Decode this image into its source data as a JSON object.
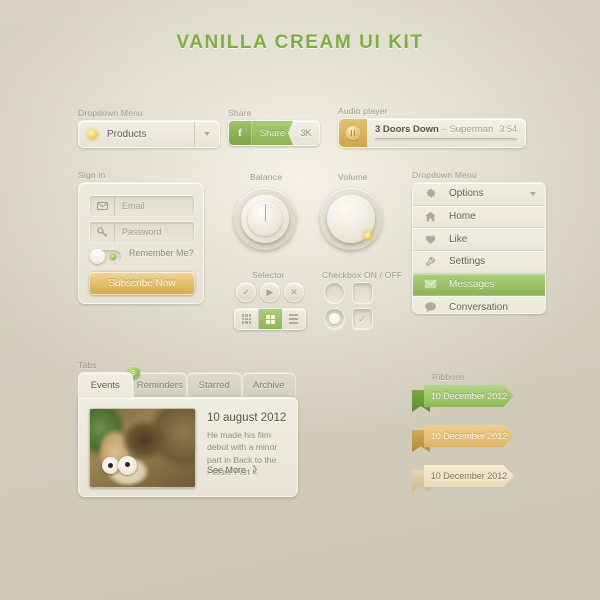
{
  "page": {
    "title": "VANILLA CREAM UI KIT"
  },
  "dropdown": {
    "caption": "Dropdown Menu",
    "selected": "Products",
    "icon": "bulb-icon",
    "caret": "chevron-down-icon"
  },
  "share": {
    "caption": "Share",
    "network_icon": "f",
    "label": "Share",
    "count": "3K"
  },
  "audio": {
    "caption": "Audio player",
    "transport_icon": "pause-icon",
    "artist": "3 Doors Down",
    "separator": " – ",
    "song": "Superman",
    "time": "3:54",
    "progress_percent": 60
  },
  "signin": {
    "caption": "Sign in",
    "email_placeholder": "Email",
    "email_icon": "envelope-icon",
    "password_placeholder": "Password",
    "password_icon": "key-icon",
    "remember_label": "Remember Me?",
    "toggle_state": "off",
    "submit_label": "Subscribe Now"
  },
  "knobs": {
    "balance_caption": "Balance",
    "volume_caption": "Volume"
  },
  "selector": {
    "caption": "Selector",
    "buttons": [
      {
        "name": "check",
        "glyph": "✓"
      },
      {
        "name": "play",
        "glyph": "▶"
      },
      {
        "name": "close",
        "glyph": "✕"
      }
    ],
    "segments": [
      {
        "name": "grid-small-icon",
        "active": false
      },
      {
        "name": "grid-large-icon",
        "active": true
      },
      {
        "name": "list-icon",
        "active": false
      }
    ]
  },
  "checkbox": {
    "caption": "Checkbox ON / OFF",
    "round_off": "",
    "square_off": "",
    "round_on": "selected",
    "square_on": "✓"
  },
  "menu": {
    "caption": "Dropdown Menu",
    "items": [
      {
        "label": "Options",
        "icon": "gear-icon",
        "active": false,
        "has_caret": true
      },
      {
        "label": "Home",
        "icon": "home-icon",
        "active": false,
        "has_caret": false
      },
      {
        "label": "Like",
        "icon": "heart-icon",
        "active": false,
        "has_caret": false
      },
      {
        "label": "Settings",
        "icon": "wrench-icon",
        "active": false,
        "has_caret": false
      },
      {
        "label": "Messages",
        "icon": "envelope-icon",
        "active": true,
        "has_caret": false
      },
      {
        "label": "Conversation",
        "icon": "speech-bubble-icon",
        "active": false,
        "has_caret": false
      }
    ]
  },
  "tabs": {
    "caption": "Tabs",
    "items": [
      {
        "label": "Events",
        "active": true,
        "badge": ""
      },
      {
        "label": "Reminders",
        "active": false,
        "badge": "3"
      },
      {
        "label": "Starred",
        "active": false,
        "badge": ""
      },
      {
        "label": "Archive",
        "active": false,
        "badge": ""
      }
    ],
    "card": {
      "date": "10 august 2012",
      "body": "He made his film debut with a minor part in Back to the Future Part II",
      "see_more": "See More",
      "see_more_icon": "chevron-right-icon",
      "thumbnail": "animated-squirrel-acorn-thumbnail"
    }
  },
  "ribbons": {
    "caption": "Ribbons",
    "items": [
      {
        "label": "10 December 2012",
        "color": "#8fb857"
      },
      {
        "label": "10 December 2012",
        "color": "#dcb466"
      },
      {
        "label": "10 December 2012",
        "color": "#e9dcb9"
      }
    ]
  },
  "colors": {
    "background": "#d4cfbd",
    "accent_green": "#8fb857",
    "accent_amber": "#d2aa52",
    "title_green": "#7fae43",
    "panel": "#ebe8dd"
  }
}
